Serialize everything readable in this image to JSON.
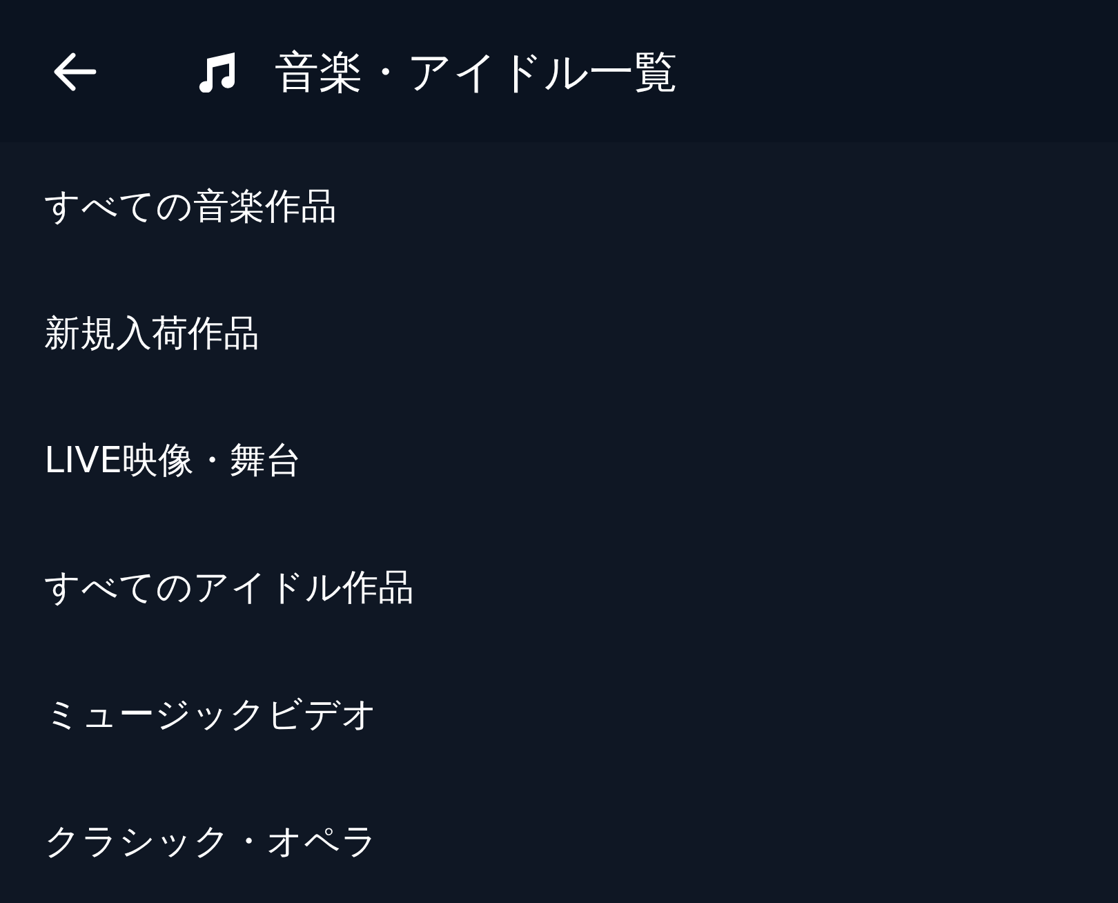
{
  "header": {
    "title": "音楽・アイドル一覧"
  },
  "menu": {
    "items": [
      {
        "label": "すべての音楽作品"
      },
      {
        "label": "新規入荷作品"
      },
      {
        "label": "LIVE映像・舞台"
      },
      {
        "label": "すべてのアイドル作品"
      },
      {
        "label": "ミュージックビデオ"
      },
      {
        "label": "クラシック・オペラ"
      }
    ]
  }
}
